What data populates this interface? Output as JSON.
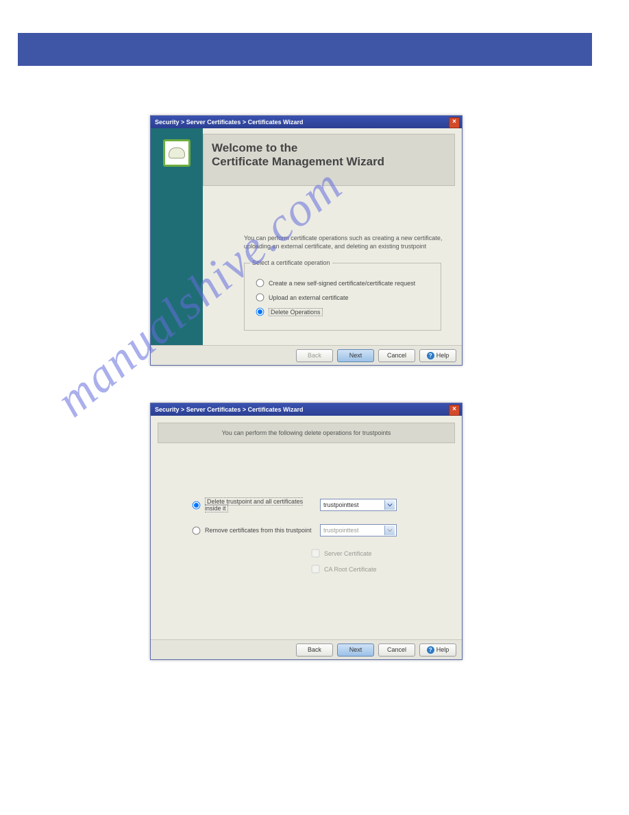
{
  "watermark_text": "manualshive.com",
  "dialog1": {
    "titlebar_text": "Security > Server Certificates > Certificates Wizard",
    "heading_line1": "Welcome to the",
    "heading_line2": "Certificate Management Wizard",
    "intro_text": "You can perform certificate operations such as creating a new certificate, uploading an external certificate, and deleting an existing trustpoint",
    "fieldset_legend": "Select a certificate operation",
    "options": [
      {
        "label": "Create a new self-signed certificate/certificate request",
        "selected": false
      },
      {
        "label": "Upload an external certificate",
        "selected": false
      },
      {
        "label": "Delete Operations",
        "selected": true
      }
    ],
    "buttons": {
      "back": "Back",
      "next": "Next",
      "cancel": "Cancel",
      "help": "Help"
    }
  },
  "dialog2": {
    "titlebar_text": "Security > Server Certificates > Certificates Wizard",
    "banner_text": "You can perform the following delete operations for trustpoints",
    "rows": [
      {
        "label": "Delete trustpoint and all certificates inside it",
        "dropdown_value": "trustpointtest",
        "selected": true,
        "dropdown_enabled": true
      },
      {
        "label": "Remove certificates from this trustpoint",
        "dropdown_value": "trustpointtest",
        "selected": false,
        "dropdown_enabled": false
      }
    ],
    "checkboxes": [
      {
        "label": "Server Certificate",
        "checked": false
      },
      {
        "label": "CA Root Certificate",
        "checked": false
      }
    ],
    "buttons": {
      "back": "Back",
      "next": "Next",
      "cancel": "Cancel",
      "help": "Help"
    }
  },
  "colors": {
    "banner_blue": "#3f55a5",
    "titlebar_blue": "#2f4295",
    "sidebar_teal": "#1f6e76"
  }
}
